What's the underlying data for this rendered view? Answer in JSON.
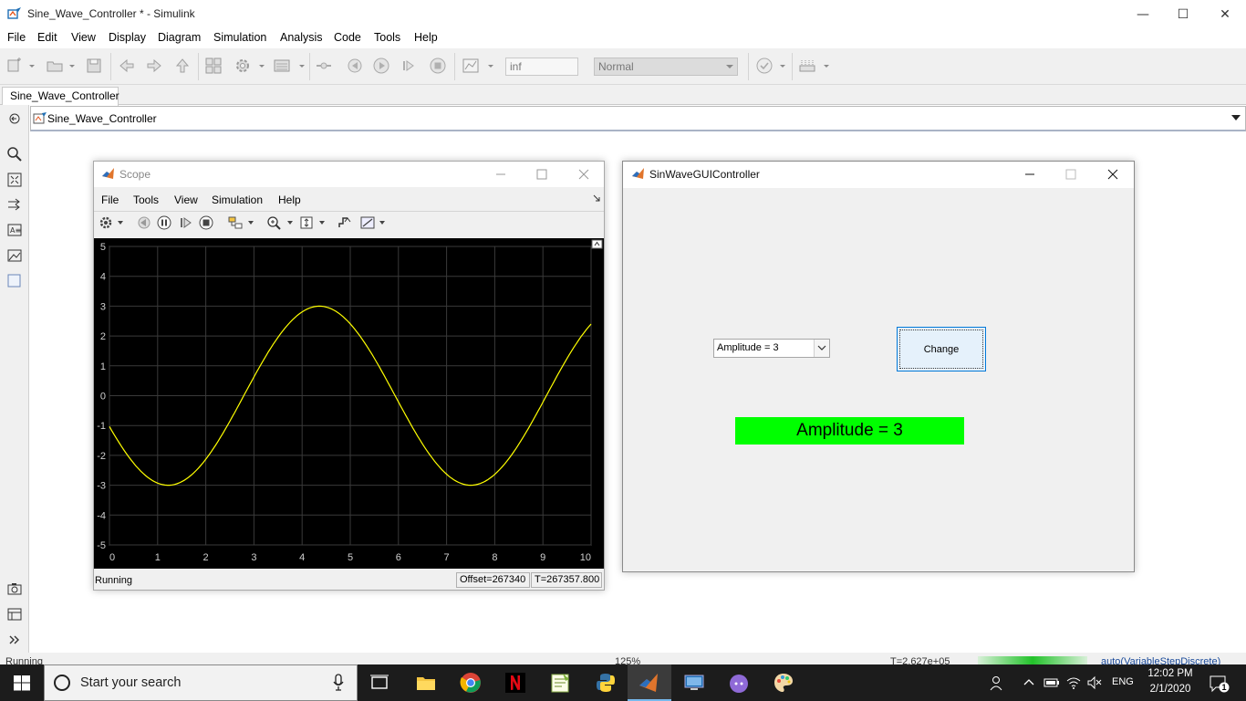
{
  "window": {
    "title": "Sine_Wave_Controller * - Simulink",
    "minimize": "—",
    "maximize": "☐",
    "close": "✕"
  },
  "menubar": {
    "items": [
      "File",
      "Edit",
      "View",
      "Display",
      "Diagram",
      "Simulation",
      "Analysis",
      "Code",
      "Tools",
      "Help"
    ]
  },
  "toolbar": {
    "stop_time": "inf",
    "sim_mode": "Normal"
  },
  "model_tab": {
    "label": "Sine_Wave_Controller"
  },
  "breadcrumb": {
    "label": "Sine_Wave_Controller"
  },
  "statusbar": {
    "state": "Running",
    "zoom": "125%",
    "time": "T=2.627e+05",
    "solver": "auto(VariableStepDiscrete)"
  },
  "scope": {
    "title": "Scope",
    "menu": [
      "File",
      "Tools",
      "View",
      "Simulation",
      "Help"
    ],
    "status": "Running",
    "offset": "Offset=267340",
    "time": "T=267357.800",
    "colors": {
      "background": "#000000",
      "grid": "#3a3a3a",
      "line": "#ffff00",
      "axis_text": "#d0d0d0"
    }
  },
  "chart_data": {
    "type": "line",
    "title": "",
    "xlabel": "",
    "ylabel": "",
    "xlim": [
      0,
      10
    ],
    "ylim": [
      -5,
      5
    ],
    "xticks": [
      "0",
      "1",
      "2",
      "3",
      "4",
      "5",
      "6",
      "7",
      "8",
      "9",
      "10"
    ],
    "yticks": [
      "5",
      "4",
      "3",
      "2",
      "1",
      "0",
      "-1",
      "-2",
      "-3",
      "-4",
      "-5"
    ],
    "grid": true,
    "series": [
      {
        "color": "#ffff00",
        "function": "sine",
        "amplitude": 3,
        "period": 6.283,
        "x_at_maximum": 4.36,
        "x": [
          0,
          0.5,
          1,
          1.25,
          1.5,
          2,
          2.5,
          3,
          3.5,
          4,
          4.36,
          4.5,
          5,
          5.5,
          6,
          6.5,
          7,
          7.5,
          7.5,
          8,
          8.5,
          9,
          9.5,
          10
        ],
        "y": [
          -1,
          -2.35,
          -2.92,
          -3,
          -2.97,
          -2.55,
          -1.75,
          -0.77,
          0.66,
          2.54,
          3,
          2.97,
          2.41,
          1.53,
          0.12,
          -1.12,
          -2.25,
          -2.97,
          -3,
          -2.8,
          -2.16,
          -1.06,
          0.12,
          2.34
        ]
      }
    ]
  },
  "gui": {
    "title": "SinWaveGUIController",
    "dropdown_value": "Amplitude = 3",
    "button_label": "Change",
    "display_text": "Amplitude = 3",
    "display_color": "#00ff00"
  },
  "taskbar": {
    "search_placeholder": "Start your search",
    "language": "ENG",
    "time": "12:02 PM",
    "date": "2/1/2020",
    "notification_count": "1"
  }
}
